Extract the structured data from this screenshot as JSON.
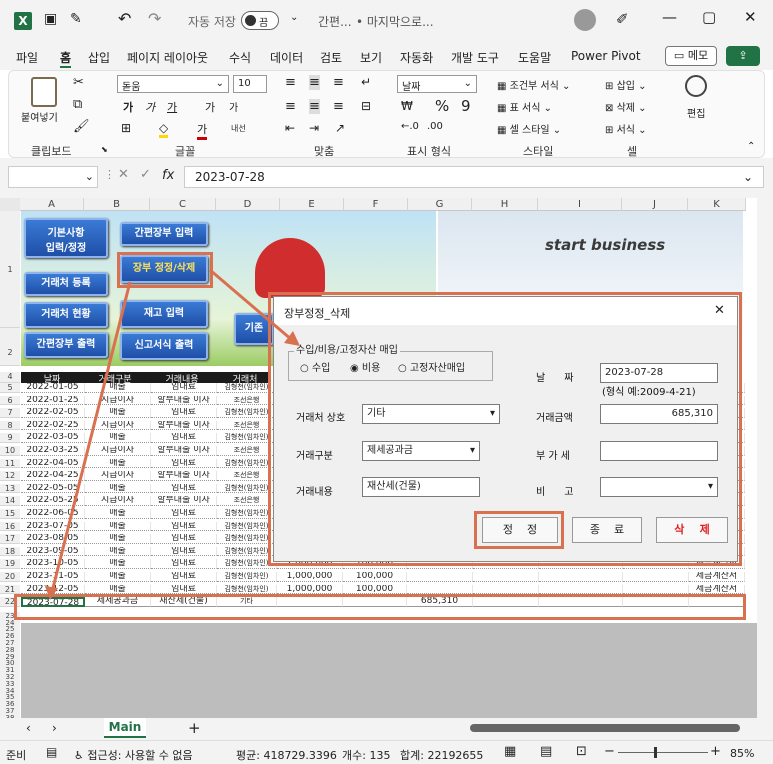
{
  "titlebar": {
    "autosave_label": "자동 저장",
    "autosave_state": "끔",
    "filename": "간편...",
    "location": "• 마지막으로..."
  },
  "menu": [
    "파일",
    "홈",
    "삽입",
    "페이지 레이아웃",
    "수식",
    "데이터",
    "검토",
    "보기",
    "자동화",
    "개발 도구",
    "도움말",
    "Power Pivot"
  ],
  "memo_label": "메모",
  "ribbon": {
    "clipboard": {
      "paste": "붙여넣기",
      "group": "클립보드"
    },
    "font": {
      "name": "돋움",
      "size": "10",
      "group": "글꼴",
      "ga1": "가",
      "ga2": "가",
      "ga3": "가",
      "ga4": "가",
      "ga5": "가",
      "gadown": "가",
      "naesm": "내선"
    },
    "align": {
      "group": "맞춤"
    },
    "number": {
      "format": "날짜",
      "group": "표시 형식"
    },
    "styles": {
      "cond": "조건부 서식",
      "table": "표 서식",
      "cell": "셀 스타일",
      "group": "스타일"
    },
    "cells": {
      "insert": "삽입",
      "delete": "삭제",
      "format": "서식",
      "group": "셀"
    },
    "edit": {
      "label": "편집"
    }
  },
  "formula": {
    "cell_ref": "",
    "fx": "fx",
    "value": "2023-07-28"
  },
  "columns": [
    "A",
    "B",
    "C",
    "D",
    "E",
    "F",
    "G",
    "H",
    "I",
    "J",
    "K"
  ],
  "sheet_buttons": {
    "b1": "기본사항\n입력/정정",
    "b2": "간편장부 입력",
    "b3": "장부 정정/삭제",
    "b4": "거래처 등록",
    "b5": "재고 입력",
    "b6": "거래처 현황",
    "b7": "간편장부 출력",
    "b8": "신고서식 출력",
    "b9": "기존",
    "start": "start business"
  },
  "header_row": [
    "날짜",
    "거래구분",
    "거래내용",
    "거래처"
  ],
  "rows": [
    {
      "n": "5",
      "d": "2022-01-05",
      "t": "매출",
      "c": "임대료",
      "p": "김형천(임차인)"
    },
    {
      "n": "6",
      "d": "2022-01-25",
      "t": "지급이자",
      "c": "할부대출 이자",
      "p": "조선은행"
    },
    {
      "n": "7",
      "d": "2022-02-05",
      "t": "매출",
      "c": "임대료",
      "p": "김형천(임차인)"
    },
    {
      "n": "8",
      "d": "2022-02-25",
      "t": "지급이자",
      "c": "할부대출 이자",
      "p": "조선은행"
    },
    {
      "n": "9",
      "d": "2022-03-05",
      "t": "매출",
      "c": "임대료",
      "p": "김형천(임차인)"
    },
    {
      "n": "10",
      "d": "2022-03-25",
      "t": "지급이자",
      "c": "할부대출 이자",
      "p": "조선은행"
    },
    {
      "n": "11",
      "d": "2022-04-05",
      "t": "매출",
      "c": "임대료",
      "p": "김형천(임차인)"
    },
    {
      "n": "12",
      "d": "2022-04-25",
      "t": "지급이자",
      "c": "할부대출 이자",
      "p": "조선은행"
    },
    {
      "n": "13",
      "d": "2022-05-05",
      "t": "매출",
      "c": "임대료",
      "p": "김형천(임차인)"
    },
    {
      "n": "14",
      "d": "2022-05-25",
      "t": "지급이자",
      "c": "할부대출 이자",
      "p": "조선은행"
    },
    {
      "n": "15",
      "d": "2022-06-05",
      "t": "매출",
      "c": "임대료",
      "p": "김형천(임차인)"
    },
    {
      "n": "16",
      "d": "2023-07-05",
      "t": "매출",
      "c": "임대료",
      "p": "김형천(임차인)"
    },
    {
      "n": "17",
      "d": "2023-08-05",
      "t": "매출",
      "c": "임대료",
      "p": "김형천(임차인)"
    },
    {
      "n": "18",
      "d": "2023-09-05",
      "t": "매출",
      "c": "임대료",
      "p": "김형천(임차인)"
    },
    {
      "n": "19",
      "d": "2023-10-05",
      "t": "매출",
      "c": "임대료",
      "p": "김형천(임차인)",
      "e": "1,000,000",
      "f": "100,000",
      "k": "세금계산서"
    },
    {
      "n": "20",
      "d": "2023-11-05",
      "t": "매출",
      "c": "임대료",
      "p": "김형천(임차인)",
      "e": "1,000,000",
      "f": "100,000",
      "k": "세금계산서"
    },
    {
      "n": "21",
      "d": "2023-12-05",
      "t": "매출",
      "c": "임대료",
      "p": "김형천(임차인)",
      "e": "1,000,000",
      "f": "100,000",
      "k": "세금계산서"
    },
    {
      "n": "22",
      "d": "2023-07-28",
      "t": "제세공과금",
      "c": "재산세(건물)",
      "p": "기타",
      "g": "685,310"
    }
  ],
  "empty_rows": [
    "23",
    "24",
    "25",
    "26",
    "27",
    "28",
    "29",
    "30",
    "31",
    "32",
    "33",
    "34",
    "35",
    "36",
    "37",
    "38",
    "39"
  ],
  "dialog": {
    "title": "장부정정_삭제",
    "group_label": "수입/비용/고정자산 매입",
    "radio_income": "수입",
    "radio_expense": "비용",
    "radio_asset": "고정자산매입",
    "date_label": "날      짜",
    "date_value": "2023-07-28",
    "date_hint": "(형식 예:2009-4-21)",
    "partner_label": "거래처 상호",
    "partner_value": "기타",
    "amount_label": "거래금액",
    "amount_value": "685,310",
    "type_label": "거래구분",
    "type_value": "제세공과금",
    "vat_label": "부 가 세",
    "vat_value": "",
    "content_label": "거래내용",
    "content_value": "재산세(건물)",
    "note_label": "비      고",
    "note_value": "",
    "btn_modify": "정    정",
    "btn_close": "종    료",
    "btn_delete": "삭    제"
  },
  "sheet_tab": "Main",
  "status": {
    "ready": "준비",
    "access": "접근성: 사용할 수 없음",
    "avg": "평균: 418729.3396",
    "count": "개수: 135",
    "sum": "합계: 22192655",
    "zoom": "85%"
  },
  "colors": {
    "excel_green": "#217346",
    "accent": "#d9704f",
    "blue_btn": "#2a5fc0"
  }
}
